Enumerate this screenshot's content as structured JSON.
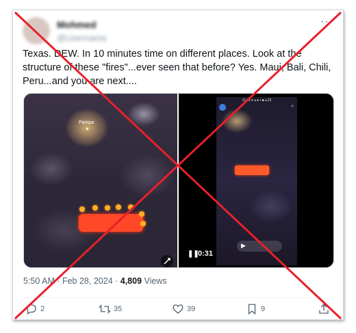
{
  "tweet": {
    "display_name": "Mohmed",
    "handle": "@Username",
    "more": "···",
    "text": "Texas. DEW. In 10 minutes time on different places. Look at the structure of these \"fires\"...ever seen that before? Yes. Maui, Bali, Chili, Peru...and you are next....",
    "meta_time": "5:50 AM · Feb 28, 2024 · ",
    "meta_views_count": "4,809",
    "meta_views_label": " Views"
  },
  "media": {
    "map_label": "Pampa",
    "video_duration": "0:31",
    "phone_status": "11:33 ▾ ◂ ● ▪ ■ ◂ 23"
  },
  "actions": {
    "reply_count": "2",
    "retweet_count": "35",
    "like_count": "39",
    "bookmark_count": "9"
  },
  "icons": [
    "reply-icon",
    "retweet-icon",
    "like-icon",
    "bookmark-icon",
    "share-icon",
    "pause-icon",
    "expand-icon"
  ],
  "colors": {
    "overlay_cross": "#e8202a",
    "fire": "#ff4a2a",
    "text_secondary": "#536471"
  }
}
